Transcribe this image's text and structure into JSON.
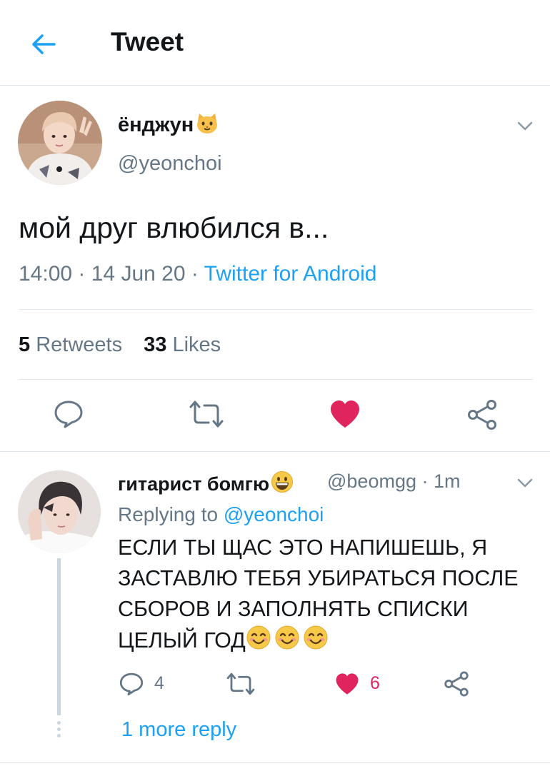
{
  "header": {
    "title": "Tweet"
  },
  "tweet": {
    "author_name": "ёнджун",
    "author_emoji": "cat-face-emoji",
    "author_handle": "@yeonchoi",
    "text": "мой друг влюбился в...",
    "time": "14:00",
    "date": "14 Jun 20",
    "source": "Twitter for Android",
    "meta_sep": " · ",
    "retweets_count": "5",
    "retweets_label": "Retweets",
    "likes_count": "33",
    "likes_label": "Likes",
    "liked": true
  },
  "reply": {
    "author_name": "гитарист бомгю",
    "author_emoji": "grinning-face-emoji",
    "author_handle": "@beomgg",
    "time": "1m",
    "time_sep": " · ",
    "replying_prefix": "Replying to ",
    "replying_to": "@yeonchoi",
    "text_lines": [
      "ЕСЛИ ТЫ ЩАС ЭТО НАПИШЕШЬ, Я",
      "ЗАСТАВЛЮ ТЕБЯ УБИРАТЬСЯ ПОСЛЕ",
      "СБОРОВ И ЗАПОЛНЯТЬ СПИСКИ",
      "ЦЕЛЫЙ ГОД"
    ],
    "text_emojis": [
      "smiling-face-emoji",
      "smiling-face-emoji",
      "smiling-face-emoji"
    ],
    "reply_count": "4",
    "like_count": "6",
    "liked": true,
    "more_replies": "1 more reply"
  },
  "colors": {
    "accent": "#1da1f2",
    "like": "#e0245e",
    "text_primary": "#14171a",
    "text_secondary": "#657786",
    "divider": "#e1e8ed"
  }
}
